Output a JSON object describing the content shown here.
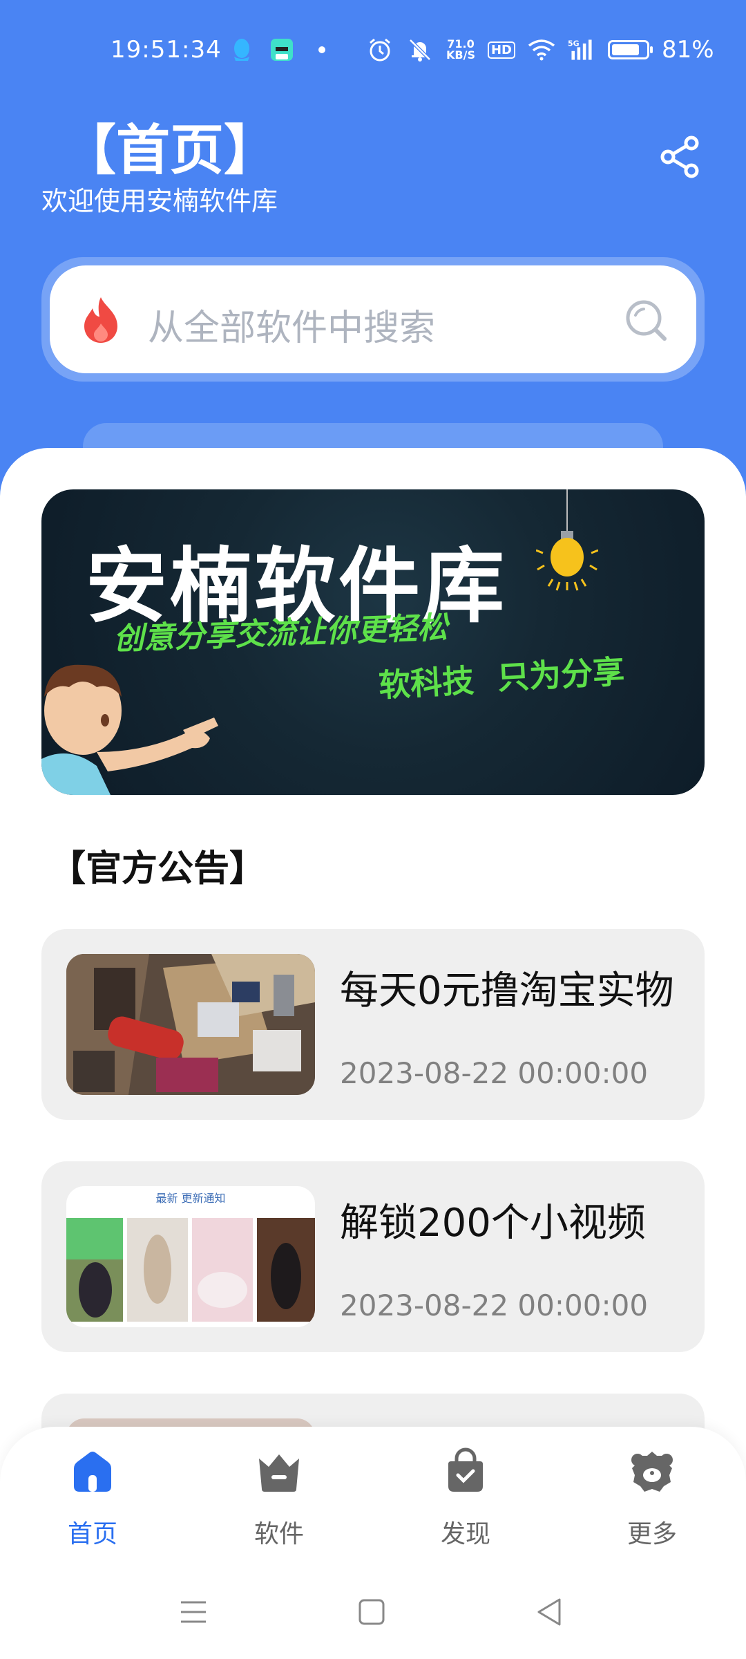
{
  "status_bar": {
    "time": "19:51:34",
    "net_speed_value": "71.0",
    "net_speed_unit": "KB/S",
    "hd_label": "HD",
    "network_label": "5G",
    "battery_text": "81%",
    "battery_level": 0.81
  },
  "header": {
    "title": "【首页】",
    "subtitle": "欢迎使用安楠软件库"
  },
  "search": {
    "placeholder": "从全部软件中搜索"
  },
  "banner": {
    "title": "安楠软件库",
    "slogan": "创意分享交流让你更轻松",
    "tag_1": "软科技",
    "tag_2": "只为分享"
  },
  "announcements": {
    "heading": "【官方公告】",
    "items": [
      {
        "title": "每天0元撸淘宝实物",
        "date": "2023-08-22 00:00:00"
      },
      {
        "title": "解锁200个小视频",
        "date": "2023-08-22 00:00:00",
        "thumb_caption": "最新 更新通知"
      }
    ]
  },
  "bottom_nav": {
    "items": [
      {
        "label": "首页",
        "icon": "home-icon"
      },
      {
        "label": "软件",
        "icon": "crown-icon"
      },
      {
        "label": "发现",
        "icon": "bag-icon"
      },
      {
        "label": "更多",
        "icon": "bear-icon"
      }
    ]
  },
  "colors": {
    "header_blue": "#4a84f3",
    "active_blue": "#2a6ff0",
    "inactive_gray": "#666666",
    "banner_green": "#5ee14a"
  }
}
